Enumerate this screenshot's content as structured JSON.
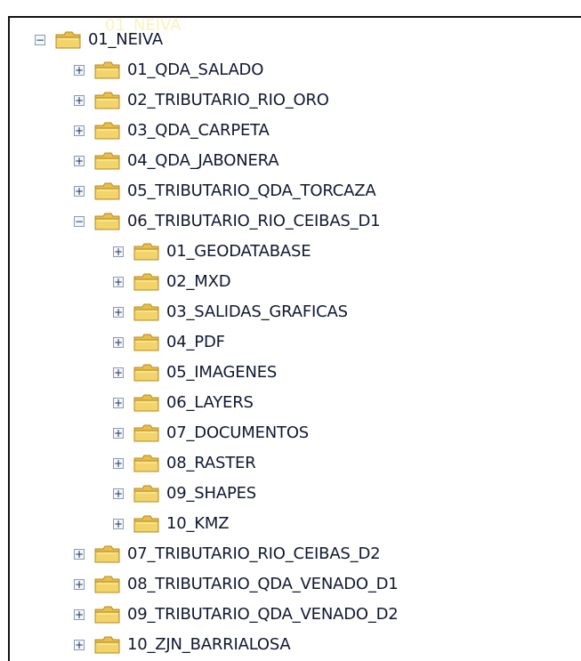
{
  "tree": {
    "expanded_symbol": "−",
    "collapsed_symbol": "+",
    "root": {
      "label": "01_NEIVA",
      "expanded": true
    },
    "children": [
      {
        "label": "01_QDA_SALADO",
        "expanded": false
      },
      {
        "label": "02_TRIBUTARIO_RIO_ORO",
        "expanded": false
      },
      {
        "label": "03_QDA_CARPETA",
        "expanded": false
      },
      {
        "label": "04_QDA_JABONERA",
        "expanded": false
      },
      {
        "label": "05_TRIBUTARIO_QDA_TORCAZA",
        "expanded": false
      },
      {
        "label": "06_TRIBUTARIO_RIO_CEIBAS_D1",
        "expanded": true
      },
      {
        "label": "07_TRIBUTARIO_RIO_CEIBAS_D2",
        "expanded": false
      },
      {
        "label": "08_TRIBUTARIO_QDA_VENADO_D1",
        "expanded": false
      },
      {
        "label": "09_TRIBUTARIO_QDA_VENADO_D2",
        "expanded": false
      },
      {
        "label": "10_ZJN_BARRIALOSA",
        "expanded": false
      }
    ],
    "subfolders": [
      {
        "label": "01_GEODATABASE",
        "expanded": false
      },
      {
        "label": "02_MXD",
        "expanded": false
      },
      {
        "label": "03_SALIDAS_GRAFICAS",
        "expanded": false
      },
      {
        "label": "04_PDF",
        "expanded": false
      },
      {
        "label": "05_IMAGENES",
        "expanded": false
      },
      {
        "label": "06_LAYERS",
        "expanded": false
      },
      {
        "label": "07_DOCUMENTOS",
        "expanded": false
      },
      {
        "label": "08_RASTER",
        "expanded": false
      },
      {
        "label": "09_SHAPES",
        "expanded": false
      },
      {
        "label": "10_KMZ",
        "expanded": false
      }
    ]
  },
  "colors": {
    "text": "#111832",
    "folder_fill": "#f2d46b",
    "folder_tab": "#e9bf47",
    "folder_outline": "#b48821",
    "expander_border": "#8b9ab1"
  },
  "icons": {
    "folder": "folder-icon",
    "expander": "expand-collapse-icon"
  }
}
